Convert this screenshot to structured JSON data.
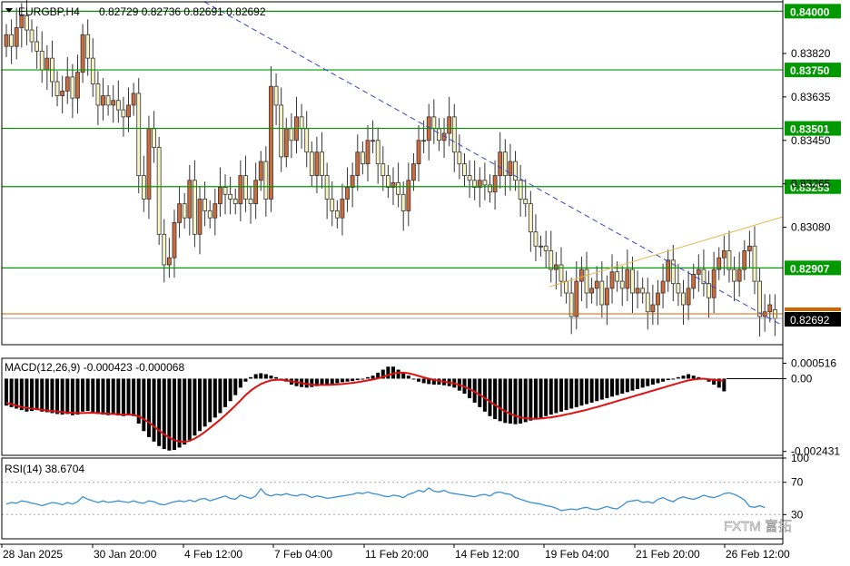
{
  "header": {
    "symbol": "EURGBP,H4",
    "ohlc": "0.82729 0.82736 0.82691 0.82692"
  },
  "watermark": {
    "text": "FXTM 富拓"
  },
  "colors": {
    "bull": "#cd6b3a",
    "bear": "#f7f4c6",
    "wick": "#333333",
    "level": "#009900",
    "trend": "#3344cc",
    "channel": "#e8b64b",
    "price_line": "#cc6600",
    "macd_hist": "#000000",
    "macd_signal": "#dd1111",
    "rsi": "#3a8fd6"
  },
  "chart_data": [
    {
      "type": "candlestick",
      "timeframe": "H4",
      "x_ticks": [
        "28 Jan 2025",
        "30 Jan 20:00",
        "4 Feb 12:00",
        "7 Feb 04:00",
        "11 Feb 20:00",
        "14 Feb 12:00",
        "19 Feb 04:00",
        "21 Feb 20:00",
        "26 Feb 12:00"
      ],
      "y_ticks": [
        0.8382,
        0.83635,
        0.8345,
        0.83265,
        0.8308
      ],
      "ylim": [
        0.8258,
        0.8404
      ],
      "levels": [
        {
          "label": "0.84000",
          "value": 0.84
        },
        {
          "label": "0.83750",
          "value": 0.8375
        },
        {
          "label": "0.83501",
          "value": 0.83501
        },
        {
          "label": "0.83253",
          "value": 0.83253
        },
        {
          "label": "0.82907",
          "value": 0.82907
        }
      ],
      "current_price": {
        "label": "0.82692",
        "value": 0.82692
      },
      "close": [
        0.839,
        0.8385,
        0.8393,
        0.8398,
        0.8392,
        0.8387,
        0.8383,
        0.8375,
        0.838,
        0.837,
        0.8364,
        0.8366,
        0.8372,
        0.8363,
        0.8374,
        0.839,
        0.838,
        0.8369,
        0.836,
        0.8364,
        0.836,
        0.8362,
        0.8358,
        0.8355,
        0.836,
        0.8365,
        0.833,
        0.832,
        0.835,
        0.8342,
        0.8305,
        0.8292,
        0.8295,
        0.831,
        0.8318,
        0.8312,
        0.8328,
        0.8305,
        0.832,
        0.8315,
        0.8312,
        0.8318,
        0.8325,
        0.8322,
        0.832,
        0.8318,
        0.833,
        0.832,
        0.8318,
        0.8328,
        0.8336,
        0.832,
        0.8368,
        0.836,
        0.8338,
        0.835,
        0.8345,
        0.8355,
        0.835,
        0.834,
        0.833,
        0.834,
        0.833,
        0.832,
        0.8315,
        0.8312,
        0.832,
        0.8325,
        0.833,
        0.834,
        0.8335,
        0.8345,
        0.8345,
        0.8335,
        0.833,
        0.8325,
        0.8327,
        0.8322,
        0.8315,
        0.8328,
        0.8335,
        0.8345,
        0.8345,
        0.8355,
        0.835,
        0.8345,
        0.8348,
        0.8355,
        0.834,
        0.8335,
        0.833,
        0.8328,
        0.8325,
        0.8328,
        0.8326,
        0.8323,
        0.833,
        0.834,
        0.833,
        0.8336,
        0.8328,
        0.832,
        0.8318,
        0.8306,
        0.83,
        0.83,
        0.8298,
        0.829,
        0.8292,
        0.8285,
        0.828,
        0.827,
        0.8285,
        0.829,
        0.828,
        0.8282,
        0.8285,
        0.8275,
        0.8282,
        0.8289,
        0.8285,
        0.8282,
        0.829,
        0.828,
        0.8282,
        0.828,
        0.8272,
        0.8275,
        0.828,
        0.8285,
        0.8294,
        0.8284,
        0.828,
        0.8275,
        0.8282,
        0.8288,
        0.829,
        0.8284,
        0.8278,
        0.829,
        0.8295,
        0.8298,
        0.829,
        0.8285,
        0.829,
        0.8298,
        0.83,
        0.8285,
        0.827,
        0.8272,
        0.8275,
        0.82692
      ],
      "open": [
        0.8385,
        0.839,
        0.8385,
        0.8393,
        0.8398,
        0.8392,
        0.8387,
        0.8383,
        0.8375,
        0.838,
        0.837,
        0.8364,
        0.8366,
        0.8372,
        0.8363,
        0.8374,
        0.839,
        0.838,
        0.8369,
        0.836,
        0.8364,
        0.836,
        0.8362,
        0.8358,
        0.8355,
        0.836,
        0.8365,
        0.833,
        0.832,
        0.835,
        0.8342,
        0.8305,
        0.8292,
        0.8295,
        0.831,
        0.8318,
        0.8312,
        0.8328,
        0.8305,
        0.832,
        0.8315,
        0.8312,
        0.8318,
        0.8325,
        0.8322,
        0.832,
        0.8318,
        0.833,
        0.832,
        0.8318,
        0.8328,
        0.8336,
        0.832,
        0.8368,
        0.836,
        0.8338,
        0.835,
        0.8345,
        0.8355,
        0.835,
        0.834,
        0.833,
        0.834,
        0.833,
        0.832,
        0.8315,
        0.8312,
        0.832,
        0.8325,
        0.833,
        0.834,
        0.8335,
        0.8345,
        0.8345,
        0.8335,
        0.833,
        0.8325,
        0.8327,
        0.8322,
        0.8315,
        0.8328,
        0.8335,
        0.8345,
        0.8345,
        0.8355,
        0.835,
        0.8345,
        0.8348,
        0.8355,
        0.834,
        0.8335,
        0.833,
        0.8328,
        0.8325,
        0.8328,
        0.8326,
        0.8323,
        0.833,
        0.834,
        0.833,
        0.8336,
        0.8328,
        0.832,
        0.8318,
        0.8306,
        0.83,
        0.83,
        0.8298,
        0.829,
        0.8292,
        0.8285,
        0.828,
        0.827,
        0.8285,
        0.829,
        0.828,
        0.8282,
        0.8285,
        0.8275,
        0.8282,
        0.8289,
        0.8285,
        0.8282,
        0.829,
        0.828,
        0.8282,
        0.828,
        0.8272,
        0.8275,
        0.828,
        0.8285,
        0.8294,
        0.8284,
        0.828,
        0.8275,
        0.8282,
        0.8288,
        0.829,
        0.8284,
        0.8278,
        0.829,
        0.8295,
        0.8298,
        0.829,
        0.8285,
        0.829,
        0.8298,
        0.83,
        0.8285,
        0.827,
        0.8272,
        0.82729
      ]
    },
    {
      "type": "macd",
      "title": "MACD(12,26,9) -0.000423 -0.000068",
      "y_ticks": [
        0.000516,
        0.0,
        -0.002431
      ],
      "ylim": [
        -0.00256,
        0.00068
      ],
      "histogram": [
        -0.0009,
        -0.00095,
        -0.001,
        -0.00105,
        -0.0011,
        -0.00108,
        -0.00105,
        -0.0011,
        -0.00112,
        -0.00115,
        -0.00118,
        -0.0012,
        -0.00118,
        -0.00122,
        -0.0012,
        -0.0011,
        -0.00108,
        -0.00112,
        -0.00118,
        -0.0012,
        -0.00122,
        -0.0012,
        -0.00123,
        -0.00125,
        -0.0012,
        -0.00125,
        -0.0015,
        -0.00175,
        -0.00195,
        -0.0021,
        -0.00225,
        -0.00235,
        -0.0024,
        -0.00238,
        -0.0023,
        -0.0022,
        -0.00205,
        -0.0019,
        -0.00175,
        -0.0016,
        -0.00145,
        -0.0013,
        -0.00115,
        -0.00095,
        -0.00075,
        -0.00055,
        -0.0003,
        -0.0001,
        5e-05,
        0.00015,
        0.00018,
        0.00015,
        0.0001,
        5e-05,
        0.0,
        -0.0001,
        -0.0002,
        -0.00025,
        -0.00028,
        -0.0003,
        -0.00028,
        -0.00025,
        -0.00022,
        -0.0002,
        -0.00018,
        -0.00015,
        -0.00012,
        -0.0001,
        -8e-05,
        -5e-05,
        0.0,
        5e-05,
        0.0001,
        0.0002,
        0.0003,
        0.0004,
        0.0004,
        0.0003,
        0.0002,
        0.0001,
        0.0,
        -0.0001,
        -0.00015,
        -0.00018,
        -0.0002,
        -0.0002,
        -0.00022,
        -0.00025,
        -0.0003,
        -0.0004,
        -0.0005,
        -0.00065,
        -0.0008,
        -0.00095,
        -0.0011,
        -0.00125,
        -0.00135,
        -0.00142,
        -0.00148,
        -0.0015,
        -0.00152,
        -0.0015,
        -0.00145,
        -0.0014,
        -0.00135,
        -0.0013,
        -0.00125,
        -0.0012,
        -0.00115,
        -0.0011,
        -0.00105,
        -0.001,
        -0.00095,
        -0.0009,
        -0.00085,
        -0.0008,
        -0.00075,
        -0.0007,
        -0.00065,
        -0.0006,
        -0.00055,
        -0.0005,
        -0.00045,
        -0.0004,
        -0.00035,
        -0.0003,
        -0.00025,
        -0.0002,
        -0.00015,
        -0.0001,
        -5e-05,
        0.0,
        5e-05,
        0.0001,
        0.00015,
        0.0001,
        5e-05,
        0.0,
        -0.0001,
        -0.0002,
        -0.0003,
        -0.000423
      ],
      "signal": [
        -0.0008,
        -0.00085,
        -0.0009,
        -0.00095,
        -0.00098,
        -0.001,
        -0.00102,
        -0.00104,
        -0.00106,
        -0.00108,
        -0.0011,
        -0.00112,
        -0.00113,
        -0.00114,
        -0.00115,
        -0.00115,
        -0.00114,
        -0.00114,
        -0.00115,
        -0.00116,
        -0.00117,
        -0.00118,
        -0.00119,
        -0.0012,
        -0.0012,
        -0.00121,
        -0.00126,
        -0.00135,
        -0.00146,
        -0.0016,
        -0.00173,
        -0.00186,
        -0.00197,
        -0.00205,
        -0.0021,
        -0.00211,
        -0.00208,
        -0.002,
        -0.0019,
        -0.00178,
        -0.00165,
        -0.00151,
        -0.00137,
        -0.00122,
        -0.00106,
        -0.0009,
        -0.00073,
        -0.00055,
        -0.0004,
        -0.00028,
        -0.00018,
        -0.00011,
        -6e-05,
        -4e-05,
        -4e-05,
        -6e-05,
        -9e-05,
        -0.00012,
        -0.00015,
        -0.00018,
        -0.0002,
        -0.00021,
        -0.00021,
        -0.00021,
        -0.0002,
        -0.00019,
        -0.00018,
        -0.00016,
        -0.00014,
        -0.00012,
        -9e-05,
        -6e-05,
        -3e-05,
        1e-05,
        6e-05,
        0.00012,
        0.00017,
        0.0002,
        0.0002,
        0.00018,
        0.00014,
        9e-05,
        4e-05,
        0.0,
        -4e-05,
        -7e-05,
        -0.0001,
        -0.00013,
        -0.00016,
        -0.00021,
        -0.00027,
        -0.00035,
        -0.00044,
        -0.00054,
        -0.00065,
        -0.00077,
        -0.00088,
        -0.00099,
        -0.00109,
        -0.00117,
        -0.00124,
        -0.00129,
        -0.00132,
        -0.00134,
        -0.00134,
        -0.00133,
        -0.00131,
        -0.00129,
        -0.00126,
        -0.00123,
        -0.00119,
        -0.00116,
        -0.00112,
        -0.00108,
        -0.00104,
        -0.00099,
        -0.00095,
        -0.0009,
        -0.00085,
        -0.0008,
        -0.00075,
        -0.0007,
        -0.00065,
        -0.0006,
        -0.00055,
        -0.0005,
        -0.00045,
        -0.0004,
        -0.00035,
        -0.0003,
        -0.00025,
        -0.0002,
        -0.00015,
        -0.0001,
        -6e-05,
        -3e-05,
        -1e-05,
        0.0,
        -2e-05,
        -4e-05,
        -6e-05,
        -6.8e-05
      ]
    },
    {
      "type": "line",
      "title": "RSI(14) 38.6704",
      "y_ticks": [
        100,
        70,
        30
      ],
      "ylim": [
        0,
        100
      ],
      "values": [
        43,
        45,
        44,
        47,
        46,
        44,
        43,
        41,
        43,
        45,
        44,
        42,
        45,
        43,
        46,
        52,
        49,
        47,
        45,
        47,
        45,
        46,
        47,
        46,
        45,
        47,
        45,
        44,
        47,
        46,
        43,
        42,
        44,
        46,
        47,
        46,
        48,
        46,
        49,
        50,
        47,
        49,
        51,
        53,
        50,
        49,
        54,
        52,
        50,
        53,
        62,
        55,
        53,
        55,
        54,
        56,
        54,
        53,
        55,
        54,
        51,
        53,
        52,
        50,
        51,
        52,
        53,
        54,
        55,
        57,
        56,
        58,
        56,
        55,
        53,
        52,
        54,
        53,
        51,
        55,
        57,
        60,
        58,
        63,
        59,
        58,
        60,
        57,
        56,
        55,
        54,
        53,
        52,
        54,
        55,
        53,
        57,
        58,
        56,
        55,
        51,
        49,
        47,
        45,
        44,
        43,
        41,
        40,
        38,
        35,
        36,
        37,
        36,
        38,
        39,
        37,
        36,
        38,
        40,
        38,
        37,
        41,
        46,
        47,
        48,
        45,
        46,
        44,
        49,
        51,
        48,
        46,
        50,
        52,
        50,
        49,
        51,
        54,
        52,
        51,
        53,
        56,
        57,
        55,
        52,
        48,
        40,
        39,
        41,
        38.6704
      ]
    }
  ]
}
